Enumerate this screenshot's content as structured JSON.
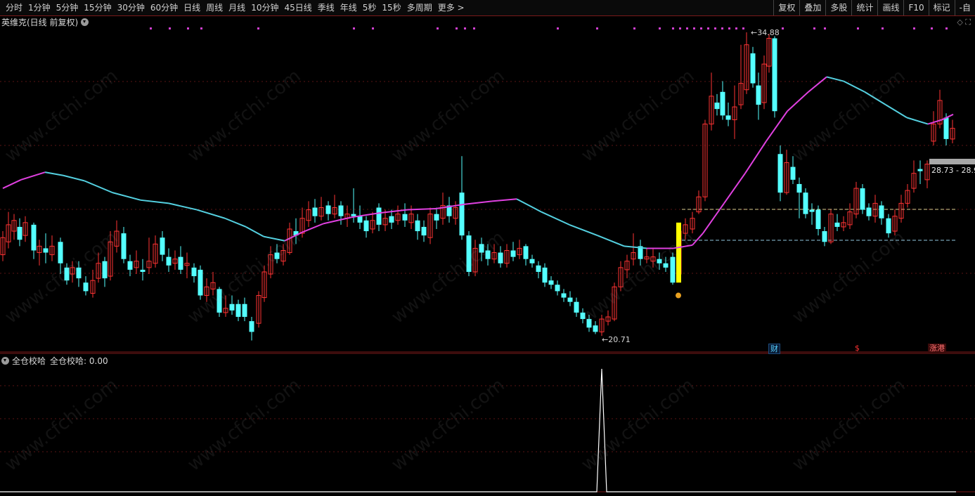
{
  "toolbar": {
    "periods": [
      "分时",
      "1分钟",
      "5分钟",
      "15分钟",
      "30分钟",
      "60分钟",
      "日线",
      "周线",
      "月线",
      "10分钟",
      "45日线",
      "季线",
      "年线",
      "5秒",
      "15秒",
      "多周期",
      "更多 >"
    ],
    "tools": [
      "复权",
      "叠加",
      "多股",
      "统计",
      "画线",
      "F10",
      "标记",
      "-自"
    ]
  },
  "main": {
    "title": "英维克(日线 前复权)",
    "high_label": "34.88",
    "low_label": "20.71",
    "price_label": "28.73 - 28.9",
    "badges": {
      "cai": "财",
      "s": "$",
      "zhang": "涨港"
    }
  },
  "sub": {
    "title": "全仓校哈",
    "value_text": "全仓校哈: 0.00"
  },
  "watermark": "www.cfchi.com",
  "colors": {
    "up": "#ff3333",
    "down": "#54ffff",
    "ma_up": "#e040e0",
    "ma_down": "#54d0e0",
    "signal": "#ffff00",
    "background": "#000000"
  }
}
